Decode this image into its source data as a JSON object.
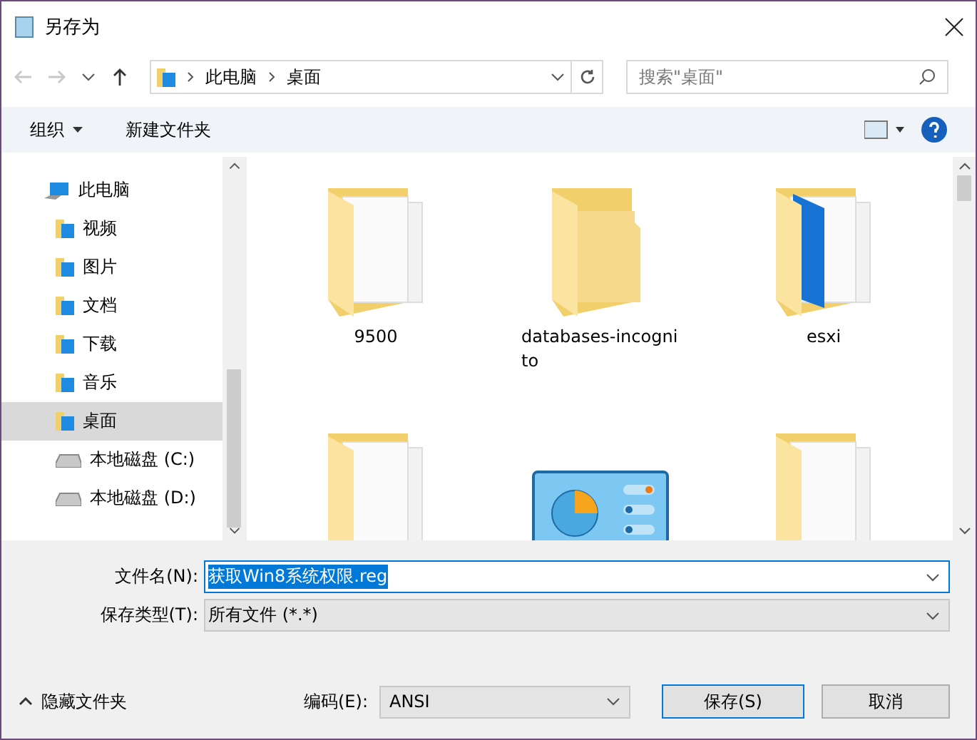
{
  "window": {
    "title": "另存为"
  },
  "address": {
    "crumbs": [
      "此电脑",
      "桌面"
    ],
    "search_placeholder": "搜索\"桌面\""
  },
  "toolbar": {
    "organize": "组织",
    "new_folder": "新建文件夹"
  },
  "sidebar": {
    "items": [
      {
        "label": "此电脑",
        "kind": "computer",
        "selected": false,
        "children": [
          {
            "label": "视频",
            "kind": "folder",
            "selected": false
          },
          {
            "label": "图片",
            "kind": "folder",
            "selected": false
          },
          {
            "label": "文档",
            "kind": "folder",
            "selected": false
          },
          {
            "label": "下载",
            "kind": "folder",
            "selected": false
          },
          {
            "label": "音乐",
            "kind": "folder",
            "selected": false
          },
          {
            "label": "桌面",
            "kind": "folder",
            "selected": true
          },
          {
            "label": "本地磁盘 (C:)",
            "kind": "drive",
            "selected": false
          },
          {
            "label": "本地磁盘 (D:)",
            "kind": "drive",
            "selected": false
          }
        ]
      }
    ]
  },
  "files": [
    {
      "label": "9500",
      "kind": "folder"
    },
    {
      "label": "databases-incognito",
      "kind": "empty-folder"
    },
    {
      "label": "esxi",
      "kind": "app-folder"
    },
    {
      "kind": "folder"
    },
    {
      "kind": "panel"
    },
    {
      "kind": "folder"
    }
  ],
  "form": {
    "filename_label": "文件名(N):",
    "filename": "获取Win8系统权限.reg",
    "type_label": "保存类型(T):",
    "type": "所有文件 (*.*)"
  },
  "footer": {
    "hide_folders": "隐藏文件夹",
    "encoding_label": "编码(E):",
    "encoding": "ANSI",
    "buttons": [
      "保存(S)",
      "取消"
    ]
  }
}
